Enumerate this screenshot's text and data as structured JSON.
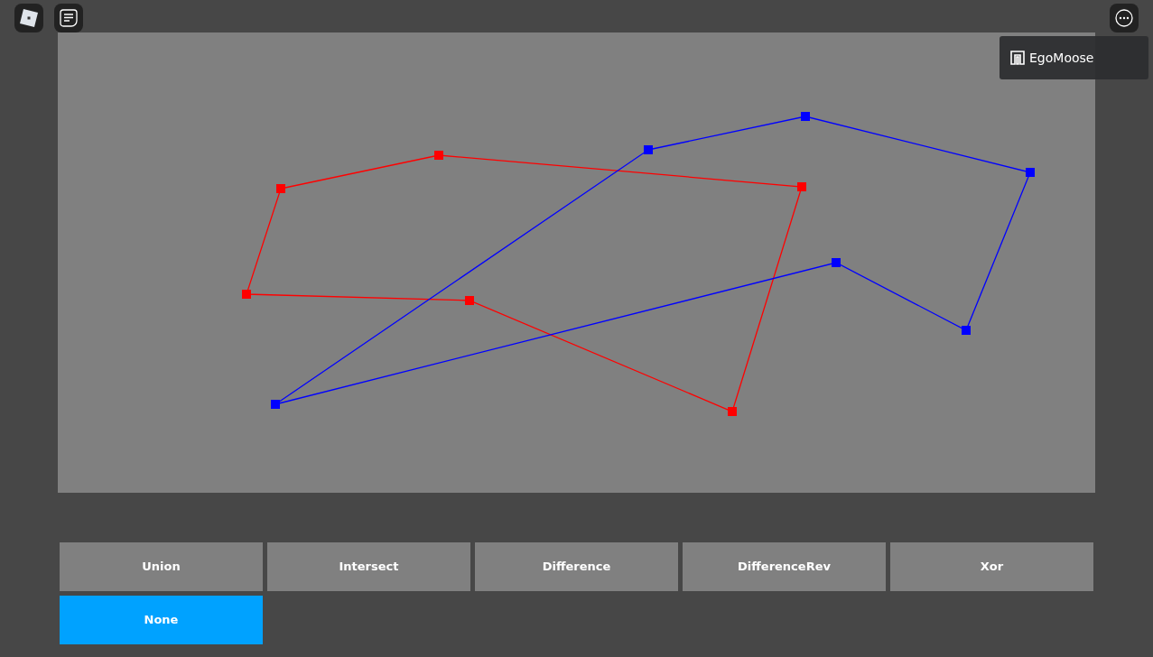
{
  "topbar": {
    "user_badge": {
      "name": "EgoMoose"
    }
  },
  "operations": [
    {
      "label": "Union",
      "selected": false
    },
    {
      "label": "Intersect",
      "selected": false
    },
    {
      "label": "Difference",
      "selected": false
    },
    {
      "label": "DifferenceRev",
      "selected": false
    },
    {
      "label": "Xor",
      "selected": false
    },
    {
      "label": "None",
      "selected": true
    }
  ]
}
